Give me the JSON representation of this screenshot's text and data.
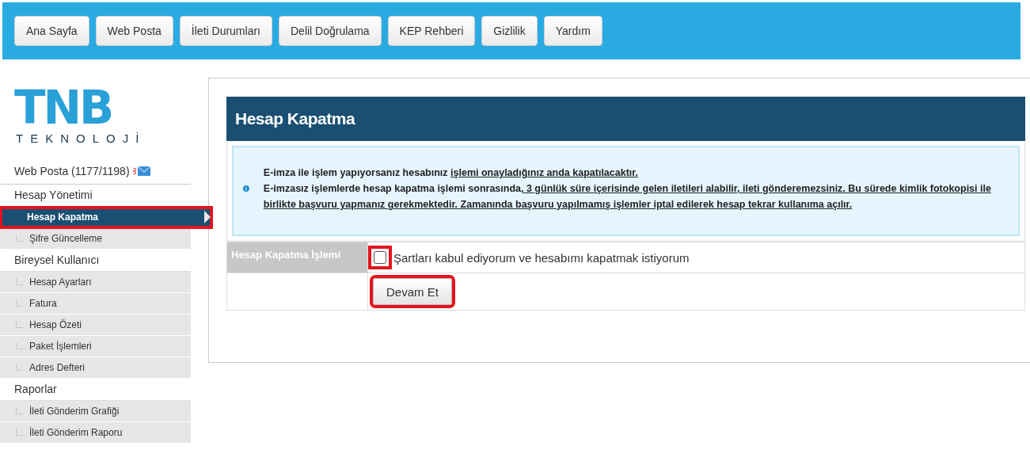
{
  "top_nav": [
    {
      "label": "Ana Sayfa"
    },
    {
      "label": "Web Posta"
    },
    {
      "label": "İleti Durumları"
    },
    {
      "label": "Delil Doğrulama"
    },
    {
      "label": "KEP Rehberi"
    },
    {
      "label": "Gizlilik"
    },
    {
      "label": "Yardım"
    }
  ],
  "logo": {
    "mark": "TNB",
    "subtitle": "TEKNOLOJİ"
  },
  "sidebar": {
    "mail_link": "Web Posta (1177/1198)",
    "sections": [
      {
        "title": "Hesap Yönetimi",
        "items": [
          {
            "label": "Hesap Kapatma",
            "selected": true,
            "highlighted": true
          },
          {
            "label": "Şifre Güncelleme",
            "selected": false,
            "highlighted": false
          }
        ]
      },
      {
        "title": "Bireysel Kullanıcı",
        "items": [
          {
            "label": "Hesap Ayarları",
            "selected": false,
            "highlighted": false
          },
          {
            "label": "Fatura",
            "selected": false,
            "highlighted": false
          },
          {
            "label": "Hesap Özeti",
            "selected": false,
            "highlighted": false
          },
          {
            "label": "Paket İşlemleri",
            "selected": false,
            "highlighted": false
          },
          {
            "label": "Adres Defteri",
            "selected": false,
            "highlighted": false
          }
        ]
      },
      {
        "title": "Raporlar",
        "items": [
          {
            "label": "İleti Gönderim Grafiği",
            "selected": false,
            "highlighted": false
          },
          {
            "label": "İleti Gönderim Raporu",
            "selected": false,
            "highlighted": false
          }
        ]
      }
    ]
  },
  "panel": {
    "title": "Hesap Kapatma",
    "info": [
      [
        {
          "text": "E-imza ile işlem yapıyorsanız hesabınız ",
          "underline": false
        },
        {
          "text": "işlemi onayladığınız anda kapatılacaktır.",
          "underline": true
        }
      ],
      [
        {
          "text": "E-imzasız işlemlerde hesap kapatma işlemi sonrasında",
          "underline": false
        },
        {
          "text": ", 3 günlük süre içerisinde gelen iletileri alabilir, ileti gönderemezsiniz. Bu sürede kimlik fotokopisi ile birlikte başvuru yapmanız gerekmektedir. Zamanında başvuru yapılmamış işlemler iptal edilerek hesap tekrar kullanıma açılır.",
          "underline": true
        }
      ]
    ],
    "form_label": "Hesap Kapatma İşlemi",
    "agree": {
      "label": "Şartları kabul ediyorum ve hesabımı kapatmak istiyorum",
      "checked": false,
      "highlighted": true
    },
    "submit": {
      "label": "Devam Et",
      "highlighted": true
    }
  }
}
